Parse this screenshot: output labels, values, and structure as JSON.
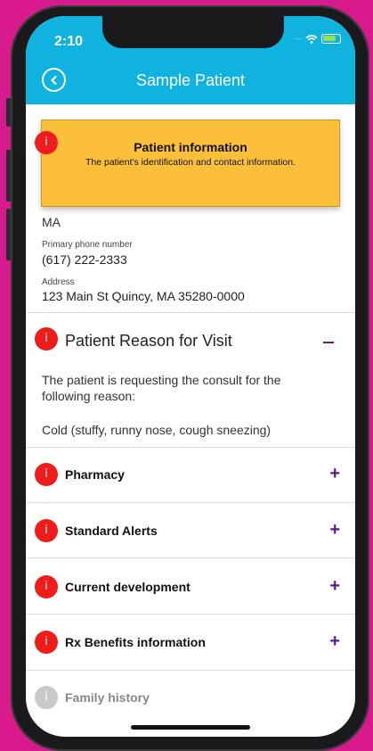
{
  "status_bar": {
    "time": "2:10"
  },
  "header": {
    "title": "Sample Patient"
  },
  "tooltip": {
    "title": "Patient information",
    "description": "The patient's identification and contact information."
  },
  "patient": {
    "state": "MA",
    "phone_label": "Primary phone number",
    "phone": "(617) 222-2333",
    "address_label": "Address",
    "address": "123 Main St Quincy, MA 35280-0000"
  },
  "reason": {
    "title": "Patient Reason for Visit",
    "intro": "The patient is requesting the consult for the following reason:",
    "reason": "Cold (stuffy, runny nose, cough sneezing)"
  },
  "sections": [
    {
      "title": "Pharmacy"
    },
    {
      "title": "Standard Alerts"
    },
    {
      "title": "Current development"
    },
    {
      "title": "Rx Benefits information"
    },
    {
      "title": "Family history"
    }
  ],
  "icons": {
    "info": "i",
    "plus": "+"
  },
  "colors": {
    "header": "#10b2e0",
    "tooltip": "#fbbf3a",
    "info": "#f01b1b",
    "accent": "#5a1a8c"
  }
}
